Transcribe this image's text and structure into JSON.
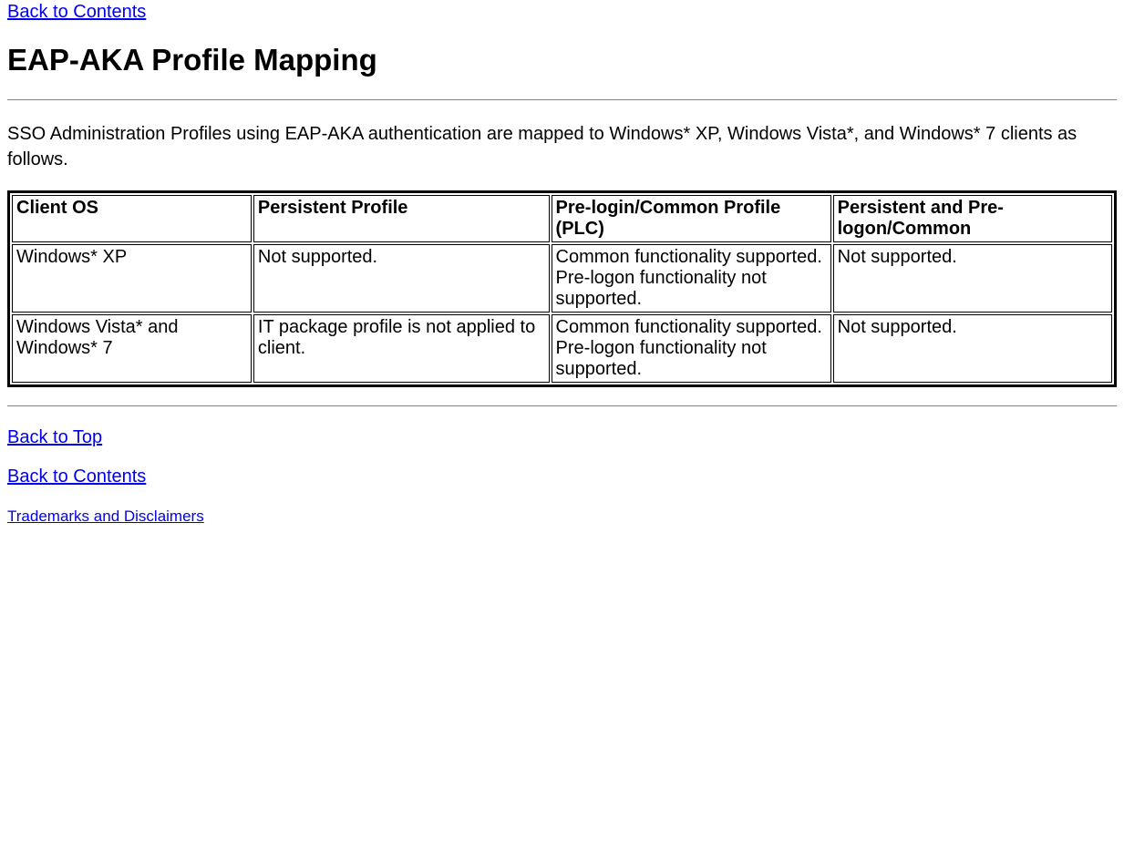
{
  "links": {
    "back_to_contents_top": "Back to Contents",
    "back_to_top": "Back to Top",
    "back_to_contents_bottom": "Back to Contents",
    "trademarks": "Trademarks and Disclaimers"
  },
  "heading": "EAP-AKA Profile Mapping",
  "intro": "SSO Administration Profiles using EAP-AKA authentication are mapped to Windows* XP, Windows Vista*, and Windows* 7 clients as follows.",
  "table": {
    "headers": {
      "col1": "Client OS",
      "col2": "Persistent Profile",
      "col3": "Pre-login/Common Profile (PLC)",
      "col4": "Persistent and Pre-logon/Common"
    },
    "rows": [
      {
        "col1": "Windows* XP",
        "col2": "Not supported.",
        "col3_line1": "Common functionality supported.",
        "col3_line2": "Pre-logon functionality not supported.",
        "col4": "Not supported."
      },
      {
        "col1": "Windows Vista* and Windows* 7",
        "col2": "IT package profile is not applied to client.",
        "col3_line1": "Common functionality supported.",
        "col3_line2": "Pre-logon functionality not supported.",
        "col4": "Not supported."
      }
    ]
  }
}
